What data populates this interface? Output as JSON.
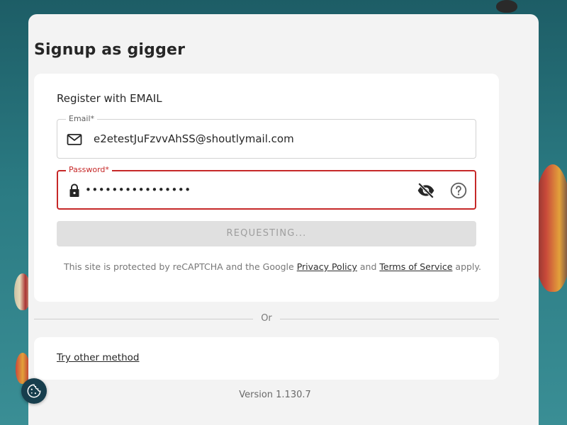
{
  "page": {
    "title": "Signup as gigger",
    "version": "Version 1.130.7"
  },
  "form": {
    "heading": "Register with EMAIL",
    "email": {
      "label": "Email*",
      "value": "e2etestJuFzvvAhSS@shoutlymail.com",
      "icon": "mail-icon"
    },
    "password": {
      "label": "Password*",
      "value": "••••••••••••••••",
      "icon": "lock-icon",
      "state": "error"
    },
    "submit_label": "REQUESTING...",
    "recaptcha": {
      "prefix": "This site is protected by reCAPTCHA and the Google",
      "privacy_link": "Privacy Policy",
      "and": "and",
      "terms_link": "Terms of Service",
      "suffix": "apply."
    }
  },
  "divider_text": "Or",
  "alt_method_link": "Try other method",
  "colors": {
    "error": "#c62828",
    "disabled_button": "#e0e0e0",
    "background_teal": "#2b7b83",
    "cookie_button": "#173e4d"
  }
}
